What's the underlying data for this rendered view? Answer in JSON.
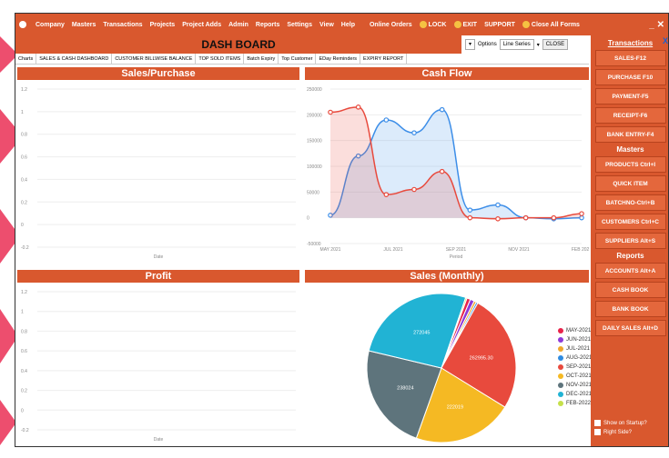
{
  "menu": {
    "items": [
      "Company",
      "Masters",
      "Transactions",
      "Projects",
      "Project Adds",
      "Admin",
      "Reports",
      "Settings",
      "View",
      "Help"
    ],
    "right_items": [
      "Online Orders",
      "LOCK",
      "EXIT",
      "SUPPORT",
      "Close All Forms"
    ],
    "window_controls": "_ ✕"
  },
  "header": {
    "title": "DASH BOARD",
    "options_label": "Options",
    "options_value": "Line Series",
    "close_label": "CLOSE"
  },
  "tabs": [
    "Charts",
    "SALES & CASH DASHBOARD",
    "CUSTOMER BILLWISE BALANCE",
    "TOP SOLD ITEMS",
    "Batch Expiry",
    "Top Customer",
    "EDay Reminders",
    "EXPIRY REPORT"
  ],
  "panels": {
    "sales_purchase": {
      "title": "Sales/Purchase",
      "xlabel": "Date",
      "yticks": [
        "1.2",
        "1",
        "0.8",
        "0.6",
        "0.4",
        "0.2",
        "0",
        "-0.2"
      ]
    },
    "cash_flow": {
      "title": "Cash Flow",
      "xlabel": "Period",
      "yticks": [
        "250000",
        "200000",
        "150000",
        "100000",
        "50000",
        "0",
        "-50000"
      ],
      "xticks": [
        "MAY 2021",
        "JUL 2021",
        "SEP 2021",
        "NOV 2021",
        "FEB 2022"
      ]
    },
    "profit": {
      "title": "Profit",
      "xlabel": "Date",
      "yticks": [
        "1.2",
        "1",
        "0.8",
        "0.6",
        "0.4",
        "0.2",
        "0",
        "-0.2"
      ]
    },
    "sales_monthly": {
      "title": "Sales (Monthly)"
    }
  },
  "chart_data": [
    {
      "type": "area",
      "title": "Cash Flow",
      "xlabel": "Period",
      "ylim": [
        -50000,
        250000
      ],
      "x": [
        "MAY 2021",
        "JUN 2021",
        "JUL 2021",
        "AUG 2021",
        "SEP 2021",
        "OCT 2021",
        "NOV 2021",
        "DEC 2021",
        "JAN 2022",
        "FEB 2022"
      ],
      "series": [
        {
          "name": "",
          "color": "#3d8ee8",
          "values": [
            5000,
            120000,
            190000,
            165000,
            210000,
            15000,
            25000,
            0,
            -2000,
            0
          ]
        },
        {
          "name": "",
          "color": "#e84a3d",
          "values": [
            205000,
            215000,
            45000,
            55000,
            90000,
            0,
            -2000,
            0,
            0,
            8000
          ]
        }
      ]
    },
    {
      "type": "pie",
      "title": "Sales (Monthly)",
      "categories": [
        "MAY-2021",
        "JUN-2021",
        "JUL-2021",
        "AUG-2021",
        "SEP-2021",
        "OCT-2021",
        "NOV-2021",
        "DEC-2021",
        "FEB-2022"
      ],
      "values": [
        8000,
        9000,
        5000,
        4000,
        262995.3,
        222019,
        238024,
        272045,
        3000
      ],
      "labels": [
        "",
        "",
        "",
        "",
        "262995.30",
        "222019",
        "238024",
        "272045",
        ""
      ],
      "colors": [
        "#e8224a",
        "#8e3ad8",
        "#f0a82c",
        "#2f8be0",
        "#e84a3d",
        "#f5b923",
        "#5e747c",
        "#21b3d4",
        "#c5e04a"
      ]
    }
  ],
  "sidebar": {
    "transactions_head": "Transactions",
    "transactions": [
      "SALES-F12",
      "PURCHASE F10",
      "PAYMENT-F5",
      "RECEIPT-F6",
      "BANK ENTRY-F4"
    ],
    "masters_head": "Masters",
    "masters": [
      "PRODUCTS Ctrl+I",
      "QUICK ITEM",
      "BATCHNO-Ctrl+B",
      "CUSTOMERS Ctrl+C",
      "SUPPLIERS Alt+S"
    ],
    "reports_head": "Reports",
    "reports": [
      "ACCOUNTS Alt+A",
      "CASH BOOK",
      "BANK BOOK",
      "DAILY SALES Alt+D"
    ],
    "show_on_startup": "Show on Startup?",
    "right_side": "Right Side?",
    "close_x": "X"
  }
}
